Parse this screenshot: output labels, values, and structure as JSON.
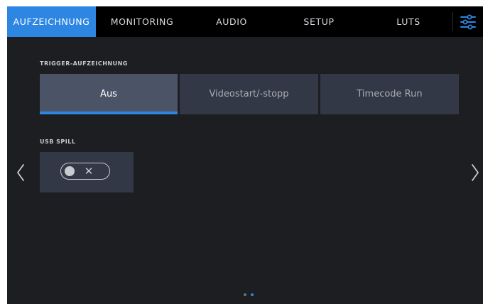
{
  "tabs": [
    {
      "label": "AUFZEICHNUNG",
      "active": true
    },
    {
      "label": "MONITORING",
      "active": false
    },
    {
      "label": "AUDIO",
      "active": false
    },
    {
      "label": "SETUP",
      "active": false
    },
    {
      "label": "LUTS",
      "active": false
    }
  ],
  "menu_icon": "settings-sliders-icon",
  "trigger_section": {
    "label": "TRIGGER-AUFZEICHNUNG",
    "options": [
      {
        "label": "Aus",
        "selected": true
      },
      {
        "label": "Videostart/-stopp",
        "selected": false
      },
      {
        "label": "Timecode Run",
        "selected": false
      }
    ]
  },
  "usb_section": {
    "label": "USB SPILL",
    "toggle": {
      "state": "off",
      "icon": "x-icon",
      "glyph": "✕"
    }
  },
  "navigation": {
    "prev_icon": "chevron-left-icon",
    "next_icon": "chevron-right-icon"
  },
  "pagination": {
    "page_count": 2,
    "current_page": 2
  },
  "colors": {
    "accent": "#2d87e2",
    "background": "#1c1e22",
    "tabbar": "#000000",
    "panel": "#323845",
    "panel_active": "#4a5466"
  }
}
